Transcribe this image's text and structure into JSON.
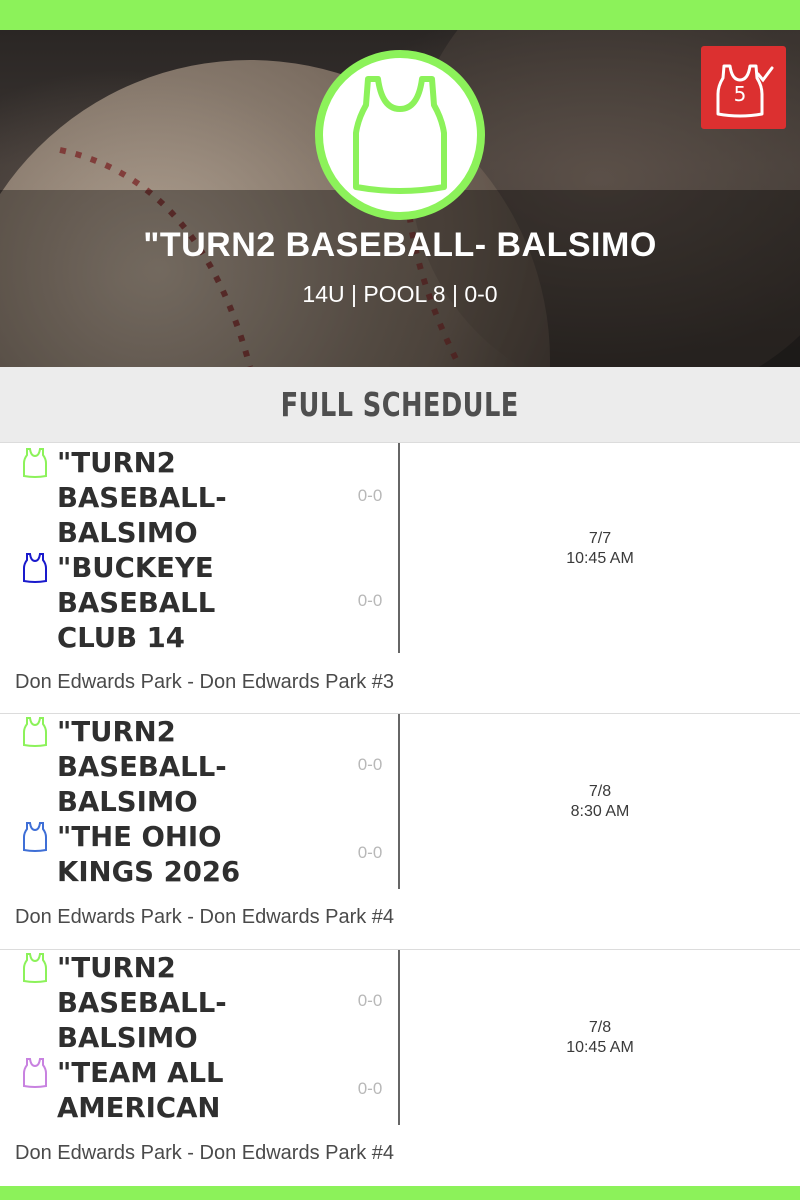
{
  "team": {
    "name": "\"TURN2 BASEBALL- BALSIMO",
    "subtitle": "14U | POOL 8 | 0-0",
    "jersey_color": "#8cf25a"
  },
  "badge": {
    "count": "5",
    "icon": "jersey-check-icon",
    "color": "#dc3030"
  },
  "section": {
    "title": "FULL SCHEDULE"
  },
  "games": [
    {
      "home": {
        "name_lines": [
          "\"TURN2",
          "BASEBALL-",
          "BALSIMO"
        ],
        "score": "0-0",
        "jersey_color": "#8cf25a"
      },
      "away": {
        "name_lines": [
          "\"BUCKEYE",
          "BASEBALL",
          "CLUB 14"
        ],
        "score": "0-0",
        "jersey_color": "#1a1acc"
      },
      "date": "7/7",
      "time": "10:45 AM",
      "venue": "Don Edwards Park - Don Edwards Park #3"
    },
    {
      "home": {
        "name_lines": [
          "\"TURN2",
          "BASEBALL-",
          "BALSIMO"
        ],
        "score": "0-0",
        "jersey_color": "#8cf25a"
      },
      "away": {
        "name_lines": [
          "\"THE OHIO",
          "KINGS 2026"
        ],
        "score": "0-0",
        "jersey_color": "#3f6fd6"
      },
      "date": "7/8",
      "time": "8:30 AM",
      "venue": "Don Edwards Park - Don Edwards Park #4"
    },
    {
      "home": {
        "name_lines": [
          "\"TURN2",
          "BASEBALL-",
          "BALSIMO"
        ],
        "score": "0-0",
        "jersey_color": "#8cf25a"
      },
      "away": {
        "name_lines": [
          "\"TEAM ALL",
          "AMERICAN"
        ],
        "score": "0-0",
        "jersey_color": "#c882e0"
      },
      "date": "7/8",
      "time": "10:45 AM",
      "venue": "Don Edwards Park - Don Edwards Park #4"
    }
  ]
}
